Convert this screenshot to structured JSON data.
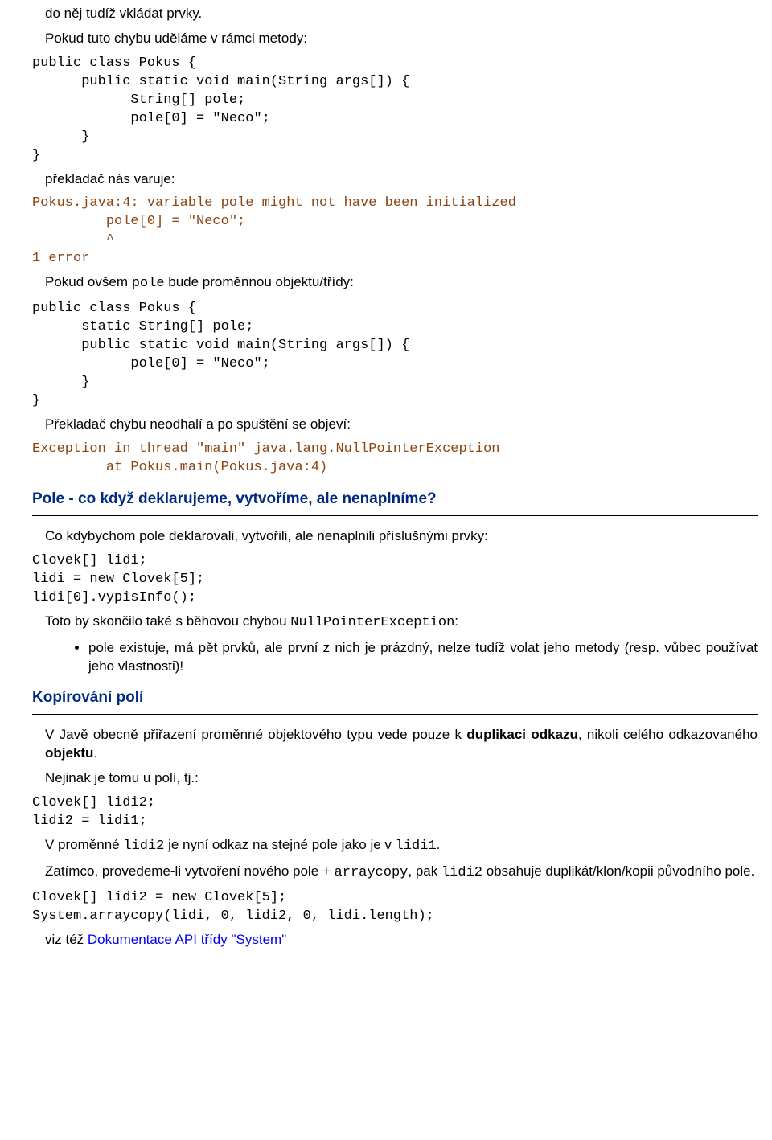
{
  "p_intro1": "do něj tudíž vkládat prvky.",
  "p_intro2": "Pokud tuto chybu uděláme v rámci metody:",
  "code1": "public class Pokus {\n      public static void main(String args[]) {\n            String[] pole;\n            pole[0] = \"Neco\";\n      }\n}",
  "p_varuje": "překladač nás varuje:",
  "out1": "Pokus.java:4: variable pole might not have been initialized\n         pole[0] = \"Neco\";\n         ^\n1 error",
  "p_ovsem_pre": "Pokud ovšem ",
  "p_ovsem_code": "pole",
  "p_ovsem_post": " bude proměnnou objektu/třídy:",
  "code2": "public class Pokus {\n      static String[] pole;\n      public static void main(String args[]) {\n            pole[0] = \"Neco\";\n      }\n}",
  "p_preklad": "Překladač chybu neodhalí a po spuštění se objeví:",
  "out2": "Exception in thread \"main\" java.lang.NullPointerException\n         at Pokus.main(Pokus.java:4)",
  "h_pole": "Pole - co když deklarujeme, vytvoříme, ale nenaplníme?",
  "p_co": "Co kdybychom pole deklarovali, vytvořili, ale nenaplnili příslušnými prvky:",
  "code3": "Clovek[] lidi;\nlidi = new Clovek[5];\nlidi[0].vypisInfo();",
  "p_toto_pre": "Toto by skončilo také s běhovou chybou ",
  "p_toto_code": "NullPointerException",
  "p_toto_post": ":",
  "bullet1": "pole existuje, má pět prvků, ale první z nich je prázdný, nelze tudíž volat jeho metody (resp. vůbec používat jeho vlastnosti)!",
  "h_kopir": "Kopírování polí",
  "p_jave_pre": "V Javě obecně přiřazení proměnné objektového typu vede pouze k ",
  "p_jave_b1": "duplikaci odkazu",
  "p_jave_mid": ", nikoli celého odkazovaného ",
  "p_jave_b2": "objektu",
  "p_jave_post": ".",
  "p_nejinak": "Nejinak je tomu u polí, tj.:",
  "code4": "Clovek[] lidi2;\nlidi2 = lidi1;",
  "p_vprom_pre": "V proměnné ",
  "p_vprom_c1": "lidi2",
  "p_vprom_mid": " je nyní odkaz na stejné pole jako je v ",
  "p_vprom_c2": "lidi1",
  "p_vprom_post": ".",
  "p_zatimco_pre": "Zatímco, provedeme-li vytvoření nového pole + ",
  "p_zatimco_c1": "arraycopy",
  "p_zatimco_mid": ", pak ",
  "p_zatimco_c2": "lidi2",
  "p_zatimco_post": " obsahuje duplikát/klon/kopii původního pole.",
  "code5": "Clovek[] lidi2 = new Clovek[5];\nSystem.arraycopy(lidi, 0, lidi2, 0, lidi.length);",
  "p_viz_pre": "viz též ",
  "p_viz_link": "Dokumentace API třídy \"System\""
}
